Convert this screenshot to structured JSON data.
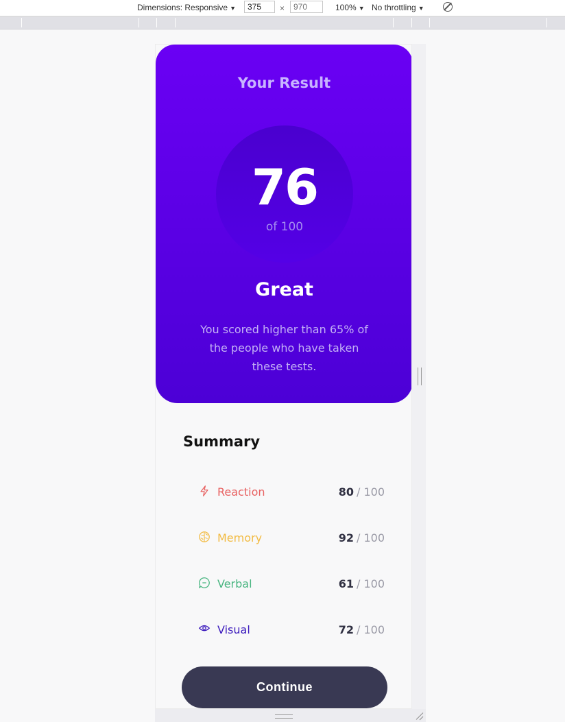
{
  "devtools": {
    "dimensions_label": "Dimensions: Responsive",
    "width_value": "375",
    "times_sign": "×",
    "height_placeholder": "970",
    "zoom": "100%",
    "throttling": "No throttling",
    "caret": "▼"
  },
  "result": {
    "title": "Your Result",
    "score": "76",
    "total": "of 100",
    "rating": "Great",
    "description": "You scored higher than 65% of the people who have taken these tests."
  },
  "summary": {
    "title": "Summary",
    "items": [
      {
        "label": "Reaction",
        "score": "80",
        "max": "/ 100",
        "color": "#e86161",
        "icon": "lightning-icon"
      },
      {
        "label": "Memory",
        "score": "92",
        "max": "/ 100",
        "color": "#f2bb43",
        "icon": "brain-icon"
      },
      {
        "label": "Verbal",
        "score": "61",
        "max": "/ 100",
        "color": "#48b580",
        "icon": "speech-bubble-icon"
      },
      {
        "label": "Visual",
        "score": "72",
        "max": "/ 100",
        "color": "#3c1bbd",
        "icon": "eye-icon"
      }
    ],
    "button_label": "Continue"
  },
  "colors": {
    "gradient_top": "#6a00f4",
    "gradient_bottom": "#4c00d6",
    "button": "#393953"
  }
}
